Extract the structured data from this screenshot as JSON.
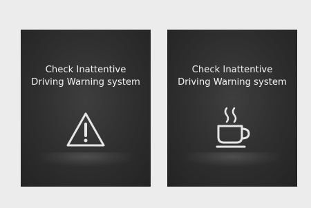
{
  "panels": [
    {
      "message_line1": "Check Inattentive",
      "message_line2": "Driving Warning system",
      "icon": "warning-triangle-icon"
    },
    {
      "message_line1": "Check Inattentive",
      "message_line2": "Driving Warning system",
      "icon": "coffee-cup-icon"
    }
  ],
  "colors": {
    "background": "#ececec",
    "panel": "#2e2e2e",
    "text": "#f2f2f2",
    "icon": "#e6e6e6"
  }
}
